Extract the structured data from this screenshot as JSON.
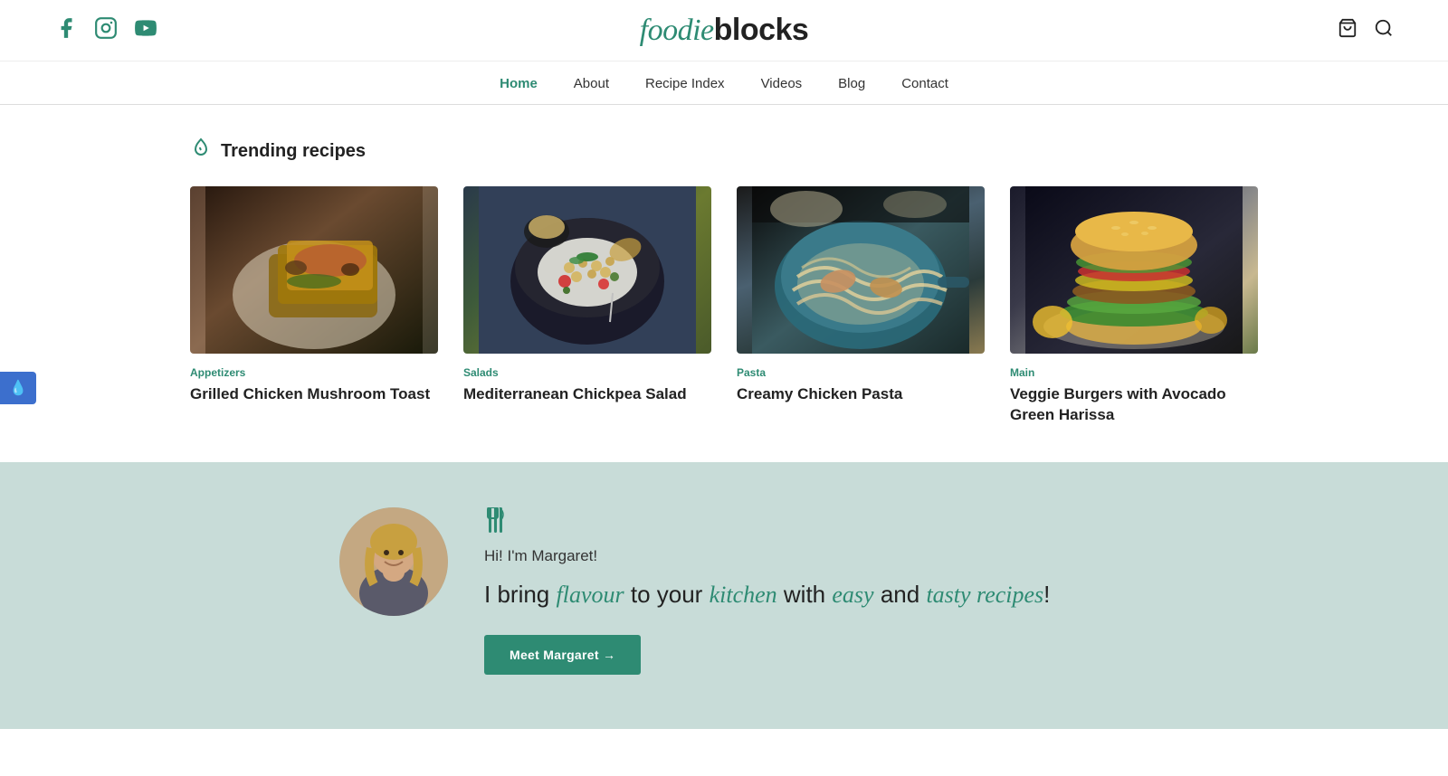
{
  "site": {
    "logo_foodie": "foodie",
    "logo_blocks": "blocks"
  },
  "social": [
    {
      "name": "facebook",
      "symbol": "f"
    },
    {
      "name": "instagram",
      "symbol": "◻"
    },
    {
      "name": "youtube",
      "symbol": "▶"
    }
  ],
  "nav": {
    "items": [
      {
        "label": "Home",
        "active": true
      },
      {
        "label": "About",
        "active": false
      },
      {
        "label": "Recipe Index",
        "active": false
      },
      {
        "label": "Videos",
        "active": false
      },
      {
        "label": "Blog",
        "active": false
      },
      {
        "label": "Contact",
        "active": false
      }
    ]
  },
  "trending": {
    "title": "Trending recipes",
    "recipes": [
      {
        "category": "Appetizers",
        "name": "Grilled Chicken Mushroom Toast",
        "img_class": "food-img-1"
      },
      {
        "category": "Salads",
        "name": "Mediterranean Chickpea Salad",
        "img_class": "food-img-2"
      },
      {
        "category": "Pasta",
        "name": "Creamy Chicken Pasta",
        "img_class": "food-img-3"
      },
      {
        "category": "Main",
        "name": "Veggie Burgers with Avocado Green Harissa",
        "img_class": "food-img-4"
      }
    ]
  },
  "about": {
    "greeting": "Hi! I'm Margaret!",
    "tagline_plain_1": "I bring",
    "tagline_italic_1": "flavour",
    "tagline_plain_2": "to your",
    "tagline_italic_2": "kitchen",
    "tagline_plain_3": "with",
    "tagline_italic_3": "easy",
    "tagline_plain_4": "and",
    "tagline_italic_4": "tasty recipes",
    "tagline_end": "!",
    "button_label": "Meet Margaret →"
  },
  "sidebar": {
    "icon": "💧"
  }
}
